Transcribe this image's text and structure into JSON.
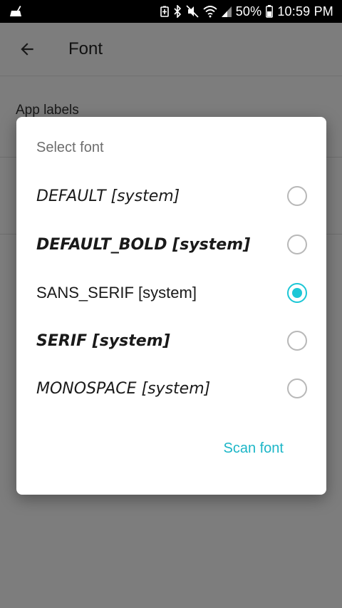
{
  "status_bar": {
    "battery": "50%",
    "time": "10:59 PM",
    "icons": [
      "cleaner-icon",
      "battery-saver-icon",
      "bluetooth-icon",
      "mute-icon",
      "wifi-icon",
      "signal-icon",
      "battery-icon"
    ]
  },
  "app_bar": {
    "title": "Font",
    "back_icon": "arrow-back-icon"
  },
  "background": {
    "section_label": "App labels"
  },
  "dialog": {
    "title": "Select font",
    "options": [
      {
        "label": "DEFAULT [system]",
        "selected": false
      },
      {
        "label": "DEFAULT_BOLD [system]",
        "selected": false
      },
      {
        "label": "SANS_SERIF [system]",
        "selected": true
      },
      {
        "label": "SERIF [system]",
        "selected": false
      },
      {
        "label": "MONOSPACE [system]",
        "selected": false
      }
    ],
    "action_label": "Scan font",
    "accent_color": "#1cc7d6"
  }
}
